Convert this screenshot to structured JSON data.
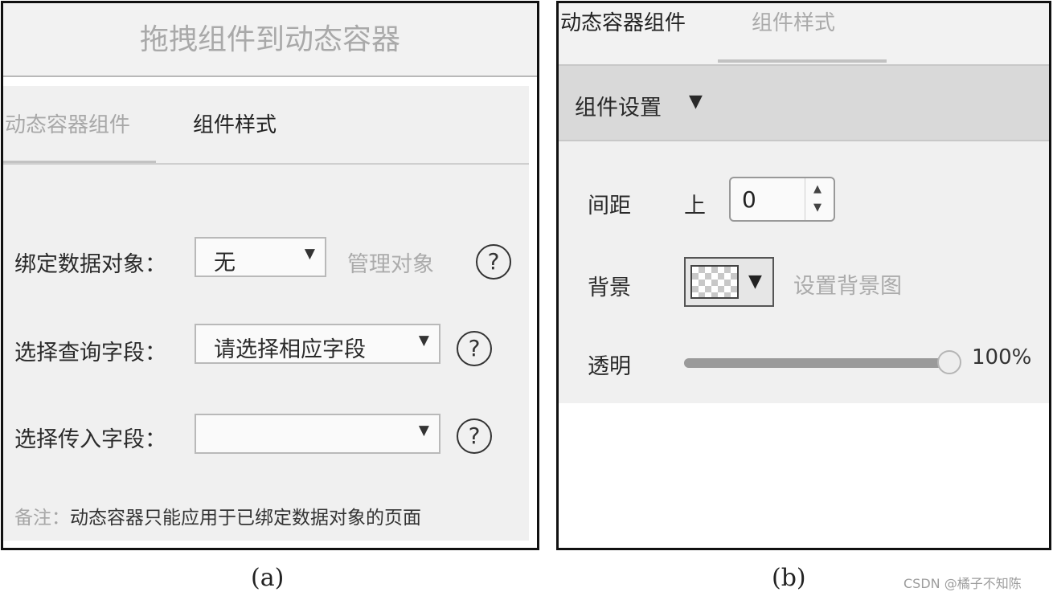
{
  "panel_a": {
    "title": "拖拽组件到动态容器",
    "tabs": [
      "动态容器组件",
      "组件样式"
    ],
    "rows": [
      {
        "label": "绑定数据对象：",
        "value": "无",
        "link": "管理对象",
        "help": "?"
      },
      {
        "label": "选择查询字段：",
        "value": "请选择相应字段",
        "help": "?"
      },
      {
        "label": "选择传入字段：",
        "value": "",
        "help": "?"
      }
    ],
    "caret": "▼",
    "note_prefix": "备注：",
    "note_text": "动态容器只能应用于已绑定数据对象的页面"
  },
  "panel_b": {
    "tabs": [
      "动态容器组件",
      "组件样式"
    ],
    "group_label": "组件设置",
    "group_caret": "▼",
    "spacing_label": "间距",
    "spacing_side": "上",
    "spacing_value": "0",
    "stepper_up": "▲",
    "stepper_down": "▼",
    "background_label": "背景",
    "background_caret": "▼",
    "background_link": "设置背景图",
    "opacity_label": "透明",
    "opacity_value": "100%",
    "opacity_fraction": 1.0
  },
  "captions": [
    "(a)",
    "(b)"
  ],
  "watermark": "CSDN @橘子不知陈",
  "colors": {
    "border": "#111111",
    "panel_bg": "#f0f0f0",
    "muted_text": "#aaaaaa",
    "group_bg": "#d9d9d9"
  }
}
